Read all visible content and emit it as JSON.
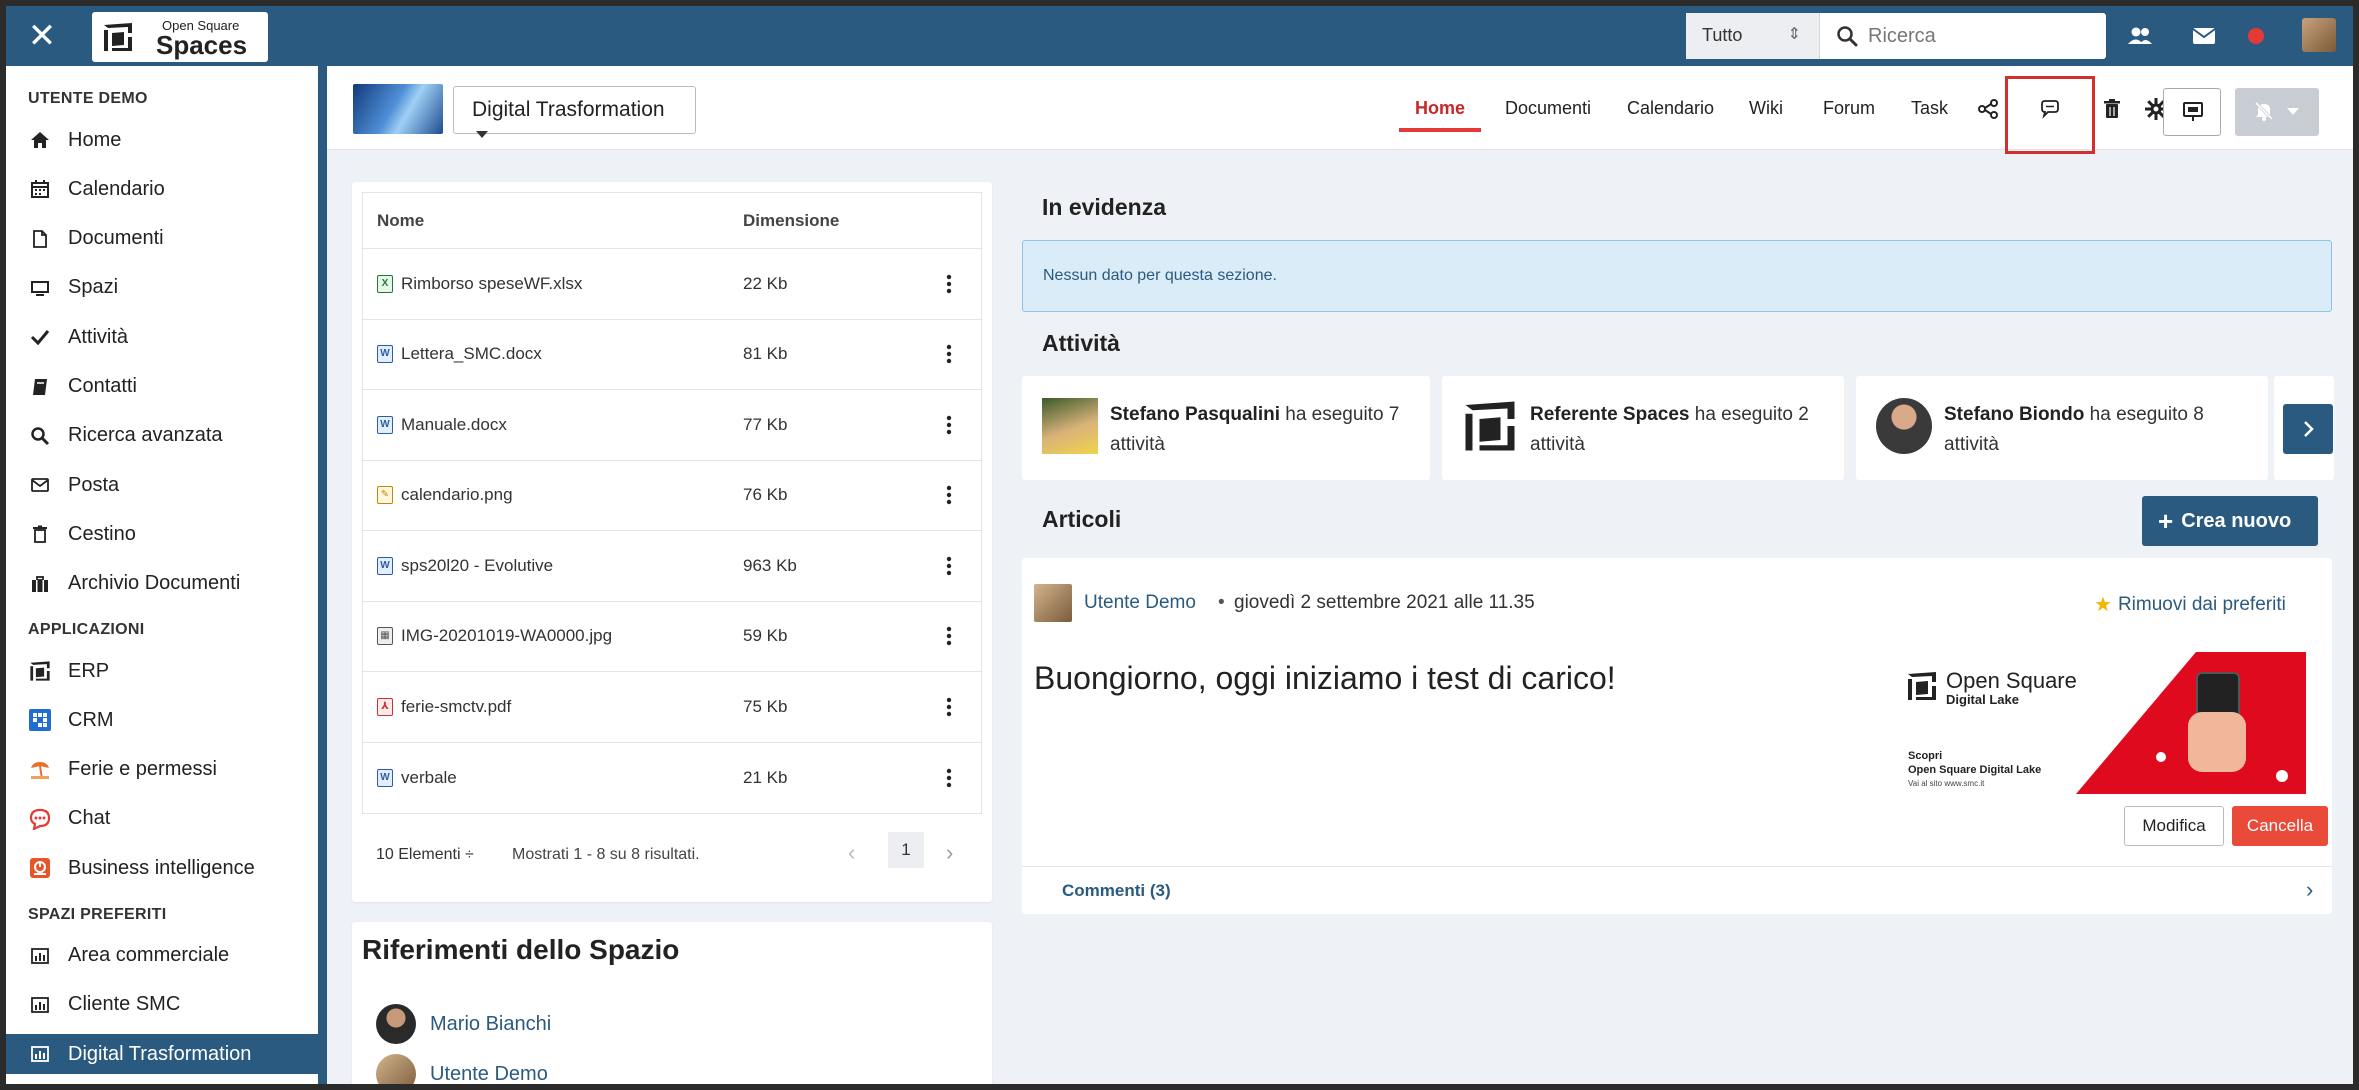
{
  "topbar": {
    "logo_small": "Open Square",
    "logo_big": "Spaces",
    "search_scope": "Tutto",
    "search_placeholder": "Ricerca"
  },
  "sidebar": {
    "sections": [
      {
        "heading": "UTENTE DEMO",
        "items": [
          {
            "label": "Home",
            "icon": "home-icon"
          },
          {
            "label": "Calendario",
            "icon": "calendar-icon"
          },
          {
            "label": "Documenti",
            "icon": "document-icon"
          },
          {
            "label": "Spazi",
            "icon": "monitor-icon"
          },
          {
            "label": "Attività",
            "icon": "check-icon"
          },
          {
            "label": "Contatti",
            "icon": "book-icon"
          },
          {
            "label": "Ricerca avanzata",
            "icon": "search-icon"
          },
          {
            "label": "Posta",
            "icon": "mail-icon"
          },
          {
            "label": "Cestino",
            "icon": "trash-icon"
          },
          {
            "label": "Archivio Documenti",
            "icon": "briefcase-icon"
          }
        ]
      },
      {
        "heading": "APPLICAZIONI",
        "items": [
          {
            "label": "ERP",
            "icon": "erp-logo-icon"
          },
          {
            "label": "CRM",
            "icon": "crm-icon"
          },
          {
            "label": "Ferie e permessi",
            "icon": "holiday-icon"
          },
          {
            "label": "Chat",
            "icon": "chat-icon"
          },
          {
            "label": "Business intelligence",
            "icon": "bi-icon"
          }
        ]
      },
      {
        "heading": "SPAZI PREFERITI",
        "items": [
          {
            "label": "Area commerciale",
            "icon": "bar-chart-icon"
          },
          {
            "label": "Cliente SMC",
            "icon": "bar-chart-icon"
          },
          {
            "label": "Digital Trasformation",
            "icon": "bar-chart-icon"
          }
        ]
      }
    ]
  },
  "space": {
    "name": "Digital Trasformation",
    "tabs": [
      "Home",
      "Documenti",
      "Calendario",
      "Wiki",
      "Forum",
      "Task"
    ],
    "active_tab": "Home"
  },
  "documents": {
    "columns": [
      "Nome",
      "Dimensione"
    ],
    "rows": [
      {
        "name": "Rimborso speseWF.xlsx",
        "size": "22 Kb",
        "type": "xlsx"
      },
      {
        "name": "Lettera_SMC.docx",
        "size": "81 Kb",
        "type": "docx"
      },
      {
        "name": "Manuale.docx",
        "size": "77 Kb",
        "type": "docx"
      },
      {
        "name": "calendario.png",
        "size": "76 Kb",
        "type": "png"
      },
      {
        "name": "sps20l20 - Evolutive",
        "size": "963 Kb",
        "type": "docx"
      },
      {
        "name": "IMG-20201019-WA0000.jpg",
        "size": "59 Kb",
        "type": "jpg"
      },
      {
        "name": "ferie-smctv.pdf",
        "size": "75 Kb",
        "type": "pdf"
      },
      {
        "name": "verbale",
        "size": "21 Kb",
        "type": "docx"
      }
    ],
    "page_size": "10 Elementi ÷",
    "results": "Mostrati 1 - 8 su 8 risultati.",
    "page": "1"
  },
  "references": {
    "title": "Riferimenti dello Spazio",
    "people": [
      "Mario Bianchi",
      "Utente Demo"
    ]
  },
  "highlights": {
    "title": "In evidenza",
    "empty": "Nessun dato per questa sezione."
  },
  "activities": {
    "title": "Attività",
    "items": [
      {
        "name": "Stefano Pasqualini",
        "text": " ha eseguito 7",
        "line2": "attività"
      },
      {
        "name": "Referente Spaces",
        "text": " ha eseguito 2",
        "line2": "attività"
      },
      {
        "name": "Stefano Biondo",
        "text": " ha eseguito 8",
        "line2": "attività"
      }
    ]
  },
  "articles": {
    "title": "Articoli",
    "new_button": "Crea nuovo",
    "item": {
      "author": "Utente Demo",
      "separator": "•",
      "date": "giovedì 2 settembre 2021 alle 11.35",
      "favorite": "Rimuovi dai preferiti",
      "headline": "Buongiorno, oggi iniziamo i test di carico!",
      "promo_brand": "Open Square",
      "promo_product": "Digital Lake",
      "promo_line1": "Scopri",
      "promo_line2": "Open Square Digital Lake",
      "promo_line3": "Vai al sito www.smc.it",
      "edit": "Modifica",
      "delete": "Cancella",
      "comments": "Commenti (3)"
    }
  },
  "colors": {
    "primary": "#2b5a80",
    "accent": "#e53935",
    "info_bg": "#d9ecf8"
  }
}
